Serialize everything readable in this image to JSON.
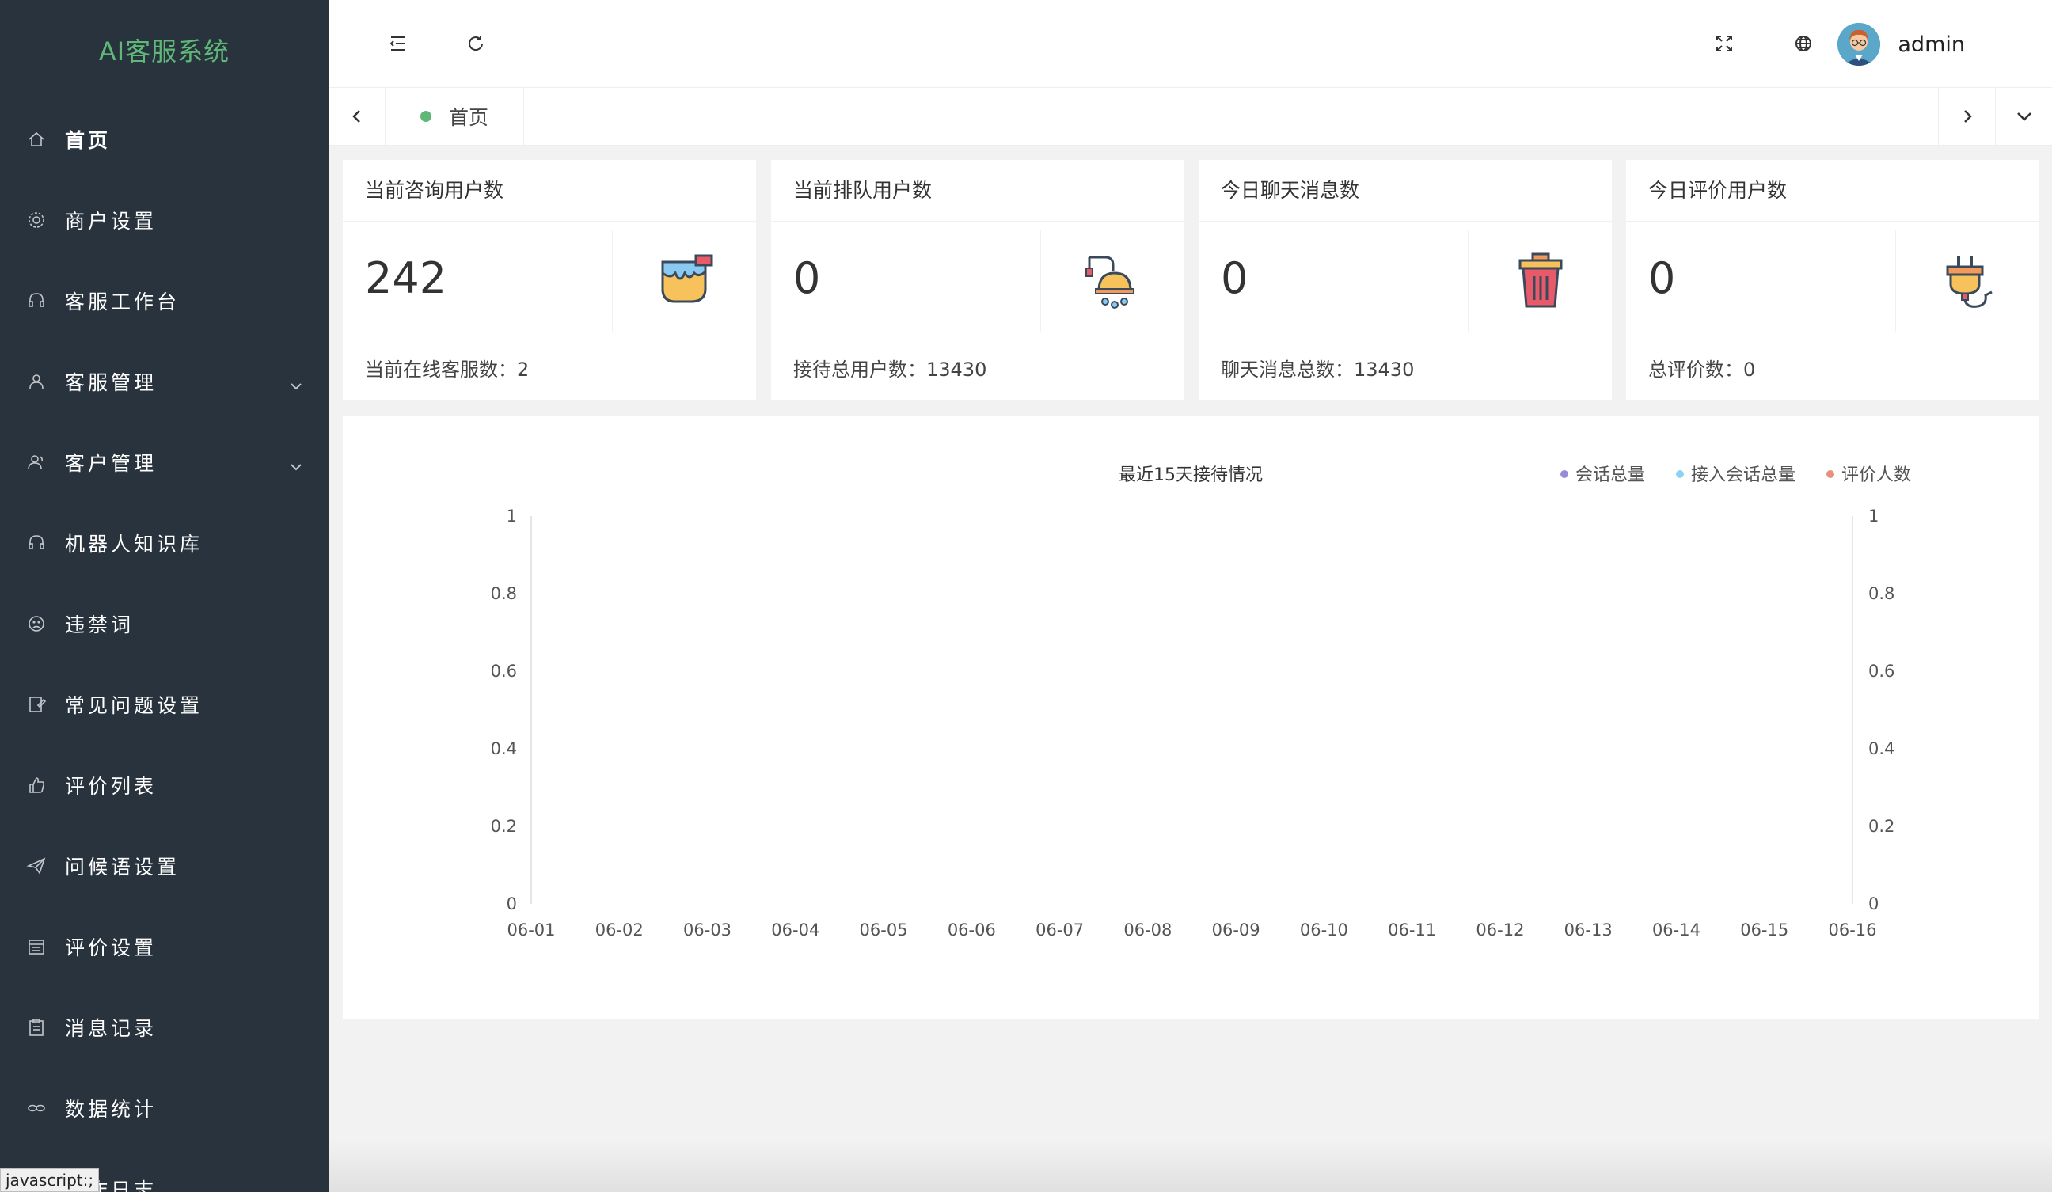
{
  "app": {
    "title": "AI客服系统"
  },
  "sidebar": {
    "items": [
      {
        "label": "首页",
        "icon": "home-icon",
        "expandable": false,
        "active": true
      },
      {
        "label": "商户设置",
        "icon": "gear-icon",
        "expandable": false
      },
      {
        "label": "客服工作台",
        "icon": "headset-icon",
        "expandable": false
      },
      {
        "label": "客服管理",
        "icon": "user-icon",
        "expandable": true
      },
      {
        "label": "客户管理",
        "icon": "users-icon",
        "expandable": true
      },
      {
        "label": "机器人知识库",
        "icon": "headset-icon",
        "expandable": false
      },
      {
        "label": "违禁词",
        "icon": "face-icon",
        "expandable": false
      },
      {
        "label": "常见问题设置",
        "icon": "edit-icon",
        "expandable": false
      },
      {
        "label": "评价列表",
        "icon": "thumb-up-icon",
        "expandable": false
      },
      {
        "label": "问候语设置",
        "icon": "send-icon",
        "expandable": false
      },
      {
        "label": "评价设置",
        "icon": "calendar-icon",
        "expandable": false
      },
      {
        "label": "消息记录",
        "icon": "clipboard-icon",
        "expandable": false
      },
      {
        "label": "数据统计",
        "icon": "link-icon",
        "expandable": false
      },
      {
        "label": "操作日志",
        "icon": "log-icon",
        "expandable": false
      }
    ]
  },
  "status_link": "javascript:;",
  "header": {
    "username": "admin"
  },
  "tabs": [
    {
      "label": "首页"
    }
  ],
  "cards": [
    {
      "title": "当前咨询用户数",
      "value": "242",
      "footer": "当前在线客服数：2",
      "icon": "paint-bucket-icon"
    },
    {
      "title": "当前排队用户数",
      "value": "0",
      "footer": "接待总用户数：13430",
      "icon": "shower-icon"
    },
    {
      "title": "今日聊天消息数",
      "value": "0",
      "footer": "聊天消息总数：13430",
      "icon": "trash-icon"
    },
    {
      "title": "今日评价用户数",
      "value": "0",
      "footer": "总评价数：0",
      "icon": "plug-icon"
    }
  ],
  "colors": {
    "sidebar_bg": "#28333e",
    "logo_green": "#5fb878",
    "series_1": "#9a8bd8",
    "series_2": "#8dd3f0",
    "series_3": "#e8907a",
    "line_gradient_start": "#c9e4a6",
    "line_gradient_end": "#ef9e8e"
  },
  "chart_data": {
    "type": "line",
    "title": "最近15天接待情况",
    "x": [
      "06-01",
      "06-02",
      "06-03",
      "06-04",
      "06-05",
      "06-06",
      "06-07",
      "06-08",
      "06-09",
      "06-10",
      "06-11",
      "06-12",
      "06-13",
      "06-14",
      "06-15",
      "06-16"
    ],
    "series": [
      {
        "name": "会话总量",
        "values": [
          0,
          0,
          0,
          0,
          0,
          0,
          0,
          0,
          0,
          0,
          0,
          0,
          0,
          0,
          0,
          0
        ]
      },
      {
        "name": "接入会话总量",
        "values": [
          0,
          0,
          0,
          0,
          0,
          0,
          0,
          0,
          0,
          0,
          0,
          0,
          0,
          0,
          0,
          0
        ]
      },
      {
        "name": "评价人数",
        "values": [
          0,
          0,
          0,
          0,
          0,
          0,
          0,
          0,
          0,
          0,
          0,
          0,
          0,
          0,
          0,
          0
        ]
      }
    ],
    "ylim": [
      0,
      1
    ],
    "y_ticks": [
      "0",
      "0.2",
      "0.4",
      "0.6",
      "0.8",
      "1"
    ],
    "y_ticks_right": [
      "0",
      "0.2",
      "0.4",
      "0.6",
      "0.8",
      "1"
    ],
    "legend_position": "top-right",
    "grid": false
  }
}
